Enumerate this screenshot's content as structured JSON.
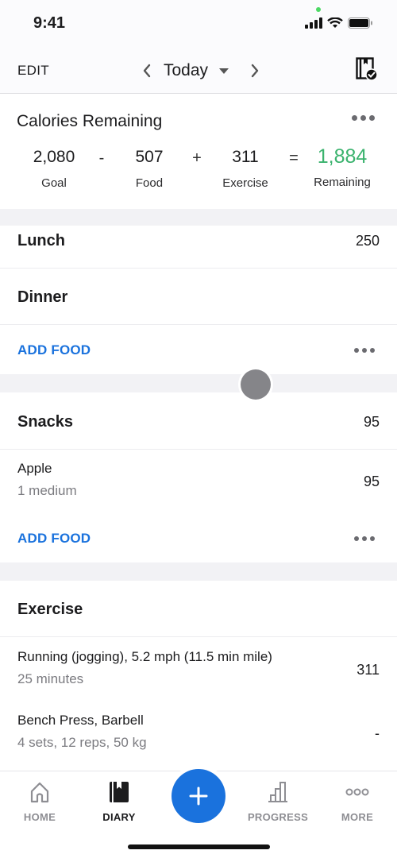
{
  "status_bar": {
    "time": "9:41"
  },
  "nav": {
    "edit_label": "EDIT",
    "date_label": "Today"
  },
  "calories": {
    "title": "Calories Remaining",
    "goal": {
      "value": "2,080",
      "label": "Goal"
    },
    "op_minus": "-",
    "food": {
      "value": "507",
      "label": "Food"
    },
    "op_plus": "+",
    "exercise": {
      "value": "311",
      "label": "Exercise"
    },
    "op_equals": "=",
    "remaining": {
      "value": "1,884",
      "label": "Remaining"
    },
    "remaining_color": "#3bb36e"
  },
  "meals": {
    "lunch": {
      "name": "Lunch",
      "calories": "250"
    },
    "dinner": {
      "name": "Dinner",
      "add_food": "ADD FOOD"
    },
    "snacks": {
      "name": "Snacks",
      "calories": "95",
      "items": [
        {
          "name": "Apple",
          "serving": "1 medium",
          "calories": "95"
        }
      ],
      "add_food": "ADD FOOD"
    }
  },
  "exercise": {
    "name": "Exercise",
    "items": [
      {
        "name": "Running (jogging), 5.2 mph (11.5 min mile)",
        "detail": "25 minutes",
        "calories": "311"
      },
      {
        "name": "Bench Press, Barbell",
        "detail": "4 sets, 12 reps, 50 kg",
        "calories": "-"
      }
    ]
  },
  "tab_bar": {
    "tabs": [
      {
        "label": "HOME",
        "icon": "home-icon"
      },
      {
        "label": "DIARY",
        "icon": "diary-icon",
        "active": true
      },
      {
        "label": "PROGRESS",
        "icon": "progress-icon"
      },
      {
        "label": "MORE",
        "icon": "more-icon"
      }
    ],
    "fab_icon": "plus-icon"
  },
  "colors": {
    "accent": "#1a72dd",
    "positive": "#3bb36e"
  }
}
